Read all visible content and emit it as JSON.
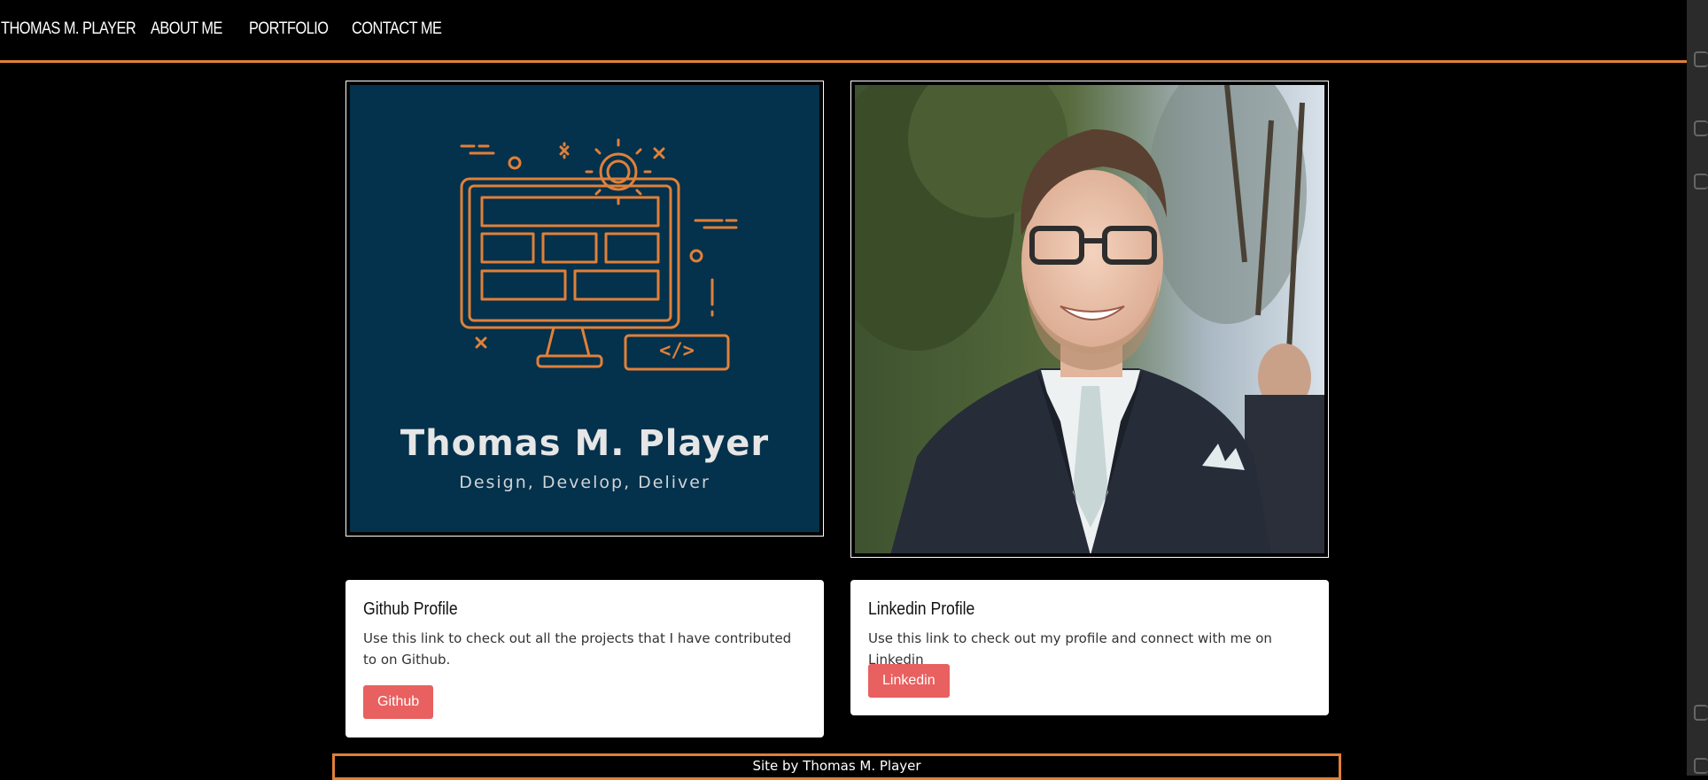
{
  "nav": {
    "brand": "THOMAS M. PLAYER",
    "links": [
      "ABOUT ME",
      "PORTFOLIO",
      "CONTACT ME"
    ]
  },
  "logo": {
    "title": "Thomas M. Player",
    "tagline": "Design, Develop, Deliver",
    "code_glyph": "</>"
  },
  "cards": [
    {
      "title": "Github Profile",
      "text": "Use this link to check out all the projects that I have contributed to on Github.",
      "button": "Github"
    },
    {
      "title": "Linkedin Profile",
      "text": "Use this link to check out my profile and connect with me on Linkedin",
      "button": "Linkedin"
    }
  ],
  "footer": {
    "text": "Site by Thomas M. Player"
  },
  "colors": {
    "accent": "#e0803a",
    "button": "#e8605f",
    "logo_bg": "#04314b"
  }
}
